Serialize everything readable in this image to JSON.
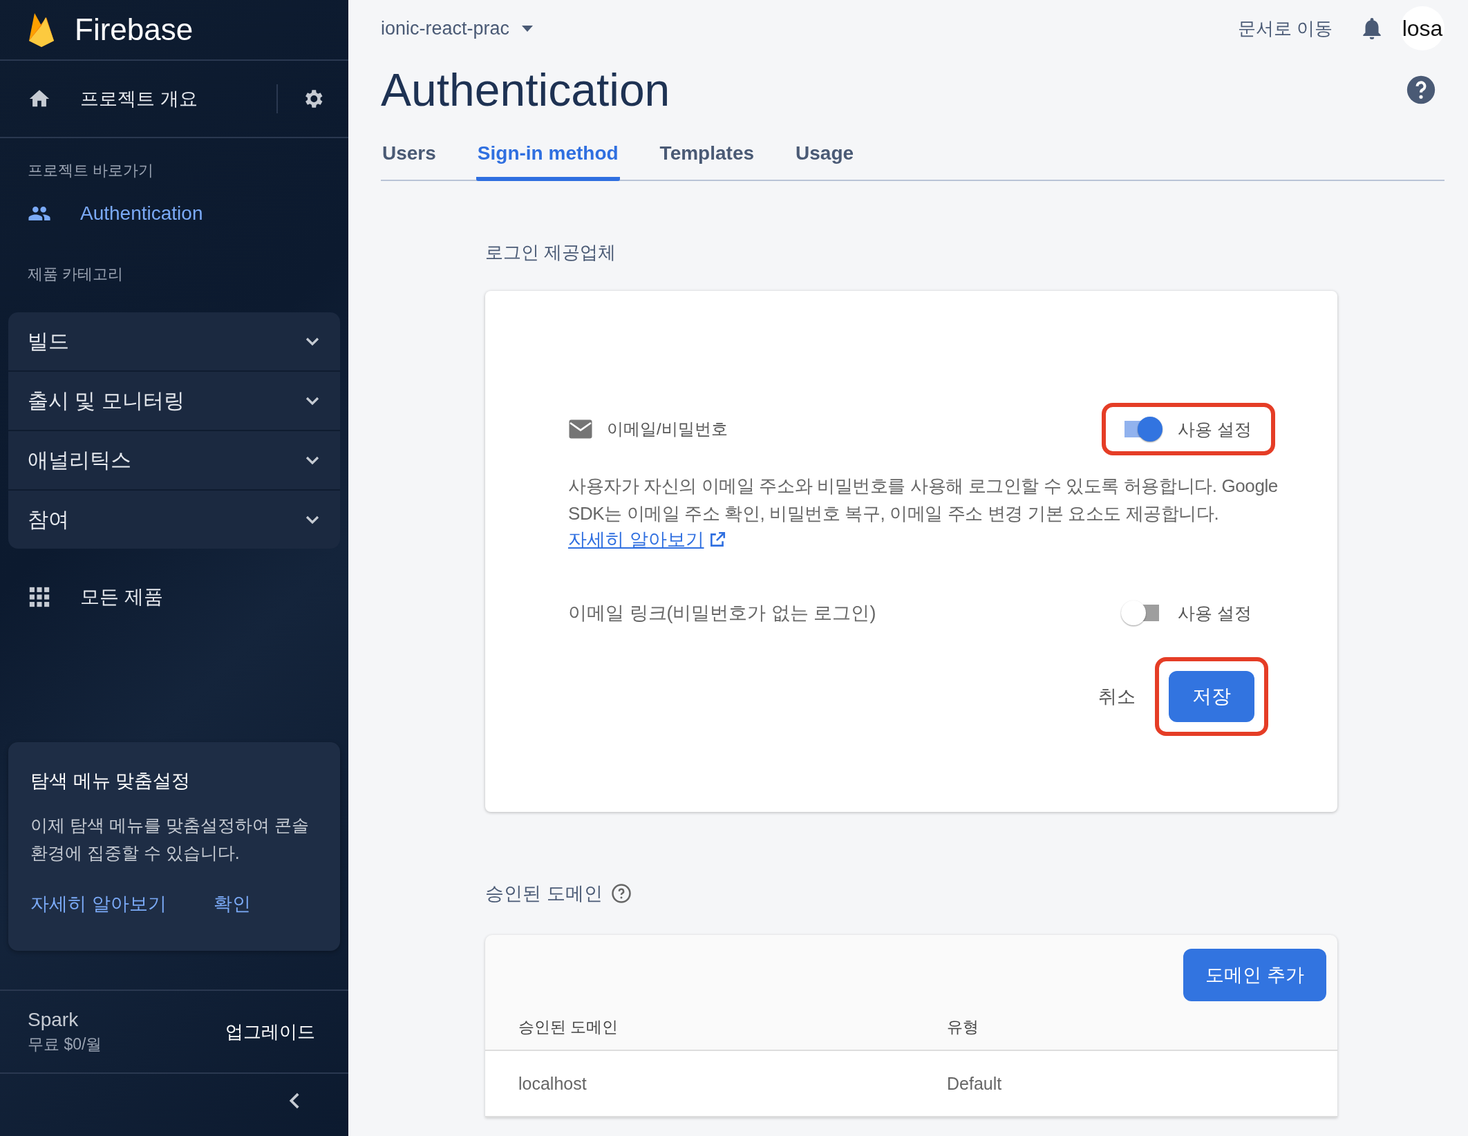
{
  "sidebar": {
    "brand": "Firebase",
    "overview": "프로젝트 개요",
    "shortcuts_label": "프로젝트 바로가기",
    "shortcuts": [
      {
        "label": "Authentication",
        "selected": true
      }
    ],
    "categories_label": "제품 카테고리",
    "categories": [
      {
        "label": "빌드",
        "expanded": false
      },
      {
        "label": "출시 및 모니터링",
        "expanded": false
      },
      {
        "label": "애널리틱스",
        "expanded": false
      },
      {
        "label": "참여",
        "expanded": false
      }
    ],
    "all_products": "모든 제품",
    "promo": {
      "title": "탐색 메뉴 맞춤설정",
      "body": "이제 탐색 메뉴를 맞춤설정하여 콘솔 환경에 집중할 수 있습니다.",
      "links": [
        "자세히 알아보기",
        "확인"
      ]
    },
    "plan": {
      "name": "Spark",
      "price": "무료 $0/월",
      "upgrade": "업그레이드"
    }
  },
  "header": {
    "project": "ionic-react-prac",
    "docs": "문서로 이동",
    "avatar": "losa"
  },
  "title": "Authentication",
  "tabs": [
    {
      "label": "Users",
      "selected": false
    },
    {
      "label": "Sign-in method",
      "selected": true
    },
    {
      "label": "Templates",
      "selected": false
    },
    {
      "label": "Usage",
      "selected": false
    }
  ],
  "providers": {
    "heading": "로그인 제공업체",
    "name": "이메일/비밀번호",
    "options": [
      {
        "label": "사용 설정",
        "on": true,
        "highlighted": true
      }
    ],
    "description": "사용자가 자신의 이메일 주소와 비밀번호를 사용해 로그인할 수 있도록 허용합니다. Google SDK는 이메일 주소 확인, 비밀번호 복구, 이메일 주소 변경 기본 요소도 제공합니다.",
    "learn_more": "자세히 알아보기",
    "link_option": {
      "label": "이메일 링크(비밀번호가 없는 로그인)",
      "toggle_label": "사용 설정",
      "on": false,
      "highlighted": false
    },
    "cancel": "취소",
    "save": {
      "label": "저장",
      "highlighted": true
    }
  },
  "domains": {
    "heading": "승인된 도메인",
    "add": "도메인 추가",
    "columns": [
      "승인된 도메인",
      "유형"
    ],
    "rows": [
      [
        "localhost",
        "Default"
      ]
    ]
  }
}
